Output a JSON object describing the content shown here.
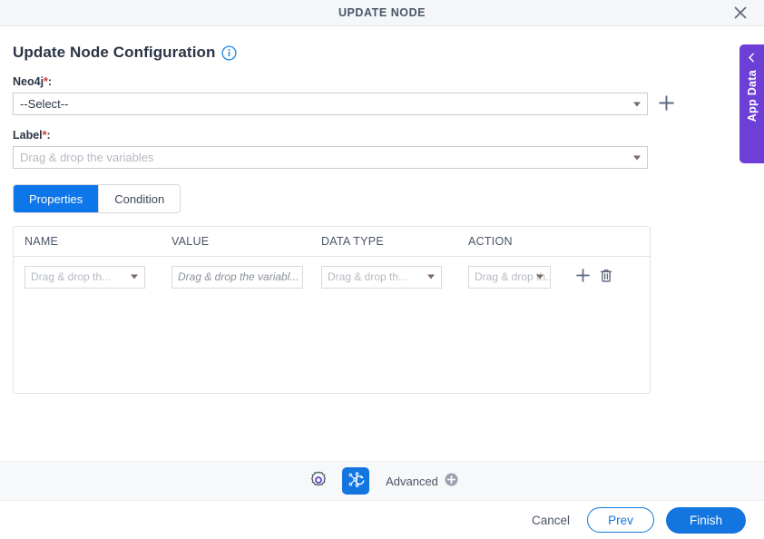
{
  "window": {
    "title": "UPDATE NODE",
    "close_icon": "close-icon"
  },
  "side_tab": {
    "label": "App Data",
    "chevron_icon": "chevron-left-icon"
  },
  "page": {
    "title": "Update Node Configuration",
    "info_icon": "info-icon"
  },
  "fields": {
    "neo4j": {
      "label": "Neo4j",
      "required_marker": "*",
      "colon": ":",
      "value": "--Select--",
      "add_icon": "plus-icon"
    },
    "label": {
      "label": "Label",
      "required_marker": "*",
      "colon": ":",
      "placeholder": "Drag & drop the variables"
    }
  },
  "tabs": [
    {
      "label": "Properties",
      "active": true
    },
    {
      "label": "Condition",
      "active": false
    }
  ],
  "table": {
    "columns": [
      "NAME",
      "VALUE",
      "DATA TYPE",
      "ACTION"
    ],
    "rows": [
      {
        "name": "Drag & drop th...",
        "value": "Drag & drop the variabl...",
        "data_type": "Drag & drop th...",
        "action": "Drag & drop th...",
        "add_icon": "plus-icon",
        "delete_icon": "trash-icon"
      }
    ]
  },
  "toolbar": {
    "settings_icon": "gear-icon",
    "node_icon": "node-refresh-icon",
    "advanced_label": "Advanced",
    "advanced_add_icon": "plus-circle-icon"
  },
  "footer": {
    "cancel_label": "Cancel",
    "prev_label": "Prev",
    "finish_label": "Finish"
  },
  "colors": {
    "accent_blue": "#1275e0",
    "tab_active_blue": "#0d76e8",
    "app_data_purple": "#6d3fd6",
    "required_red": "#d0342c",
    "gear_purple": "#6d3fd6"
  }
}
